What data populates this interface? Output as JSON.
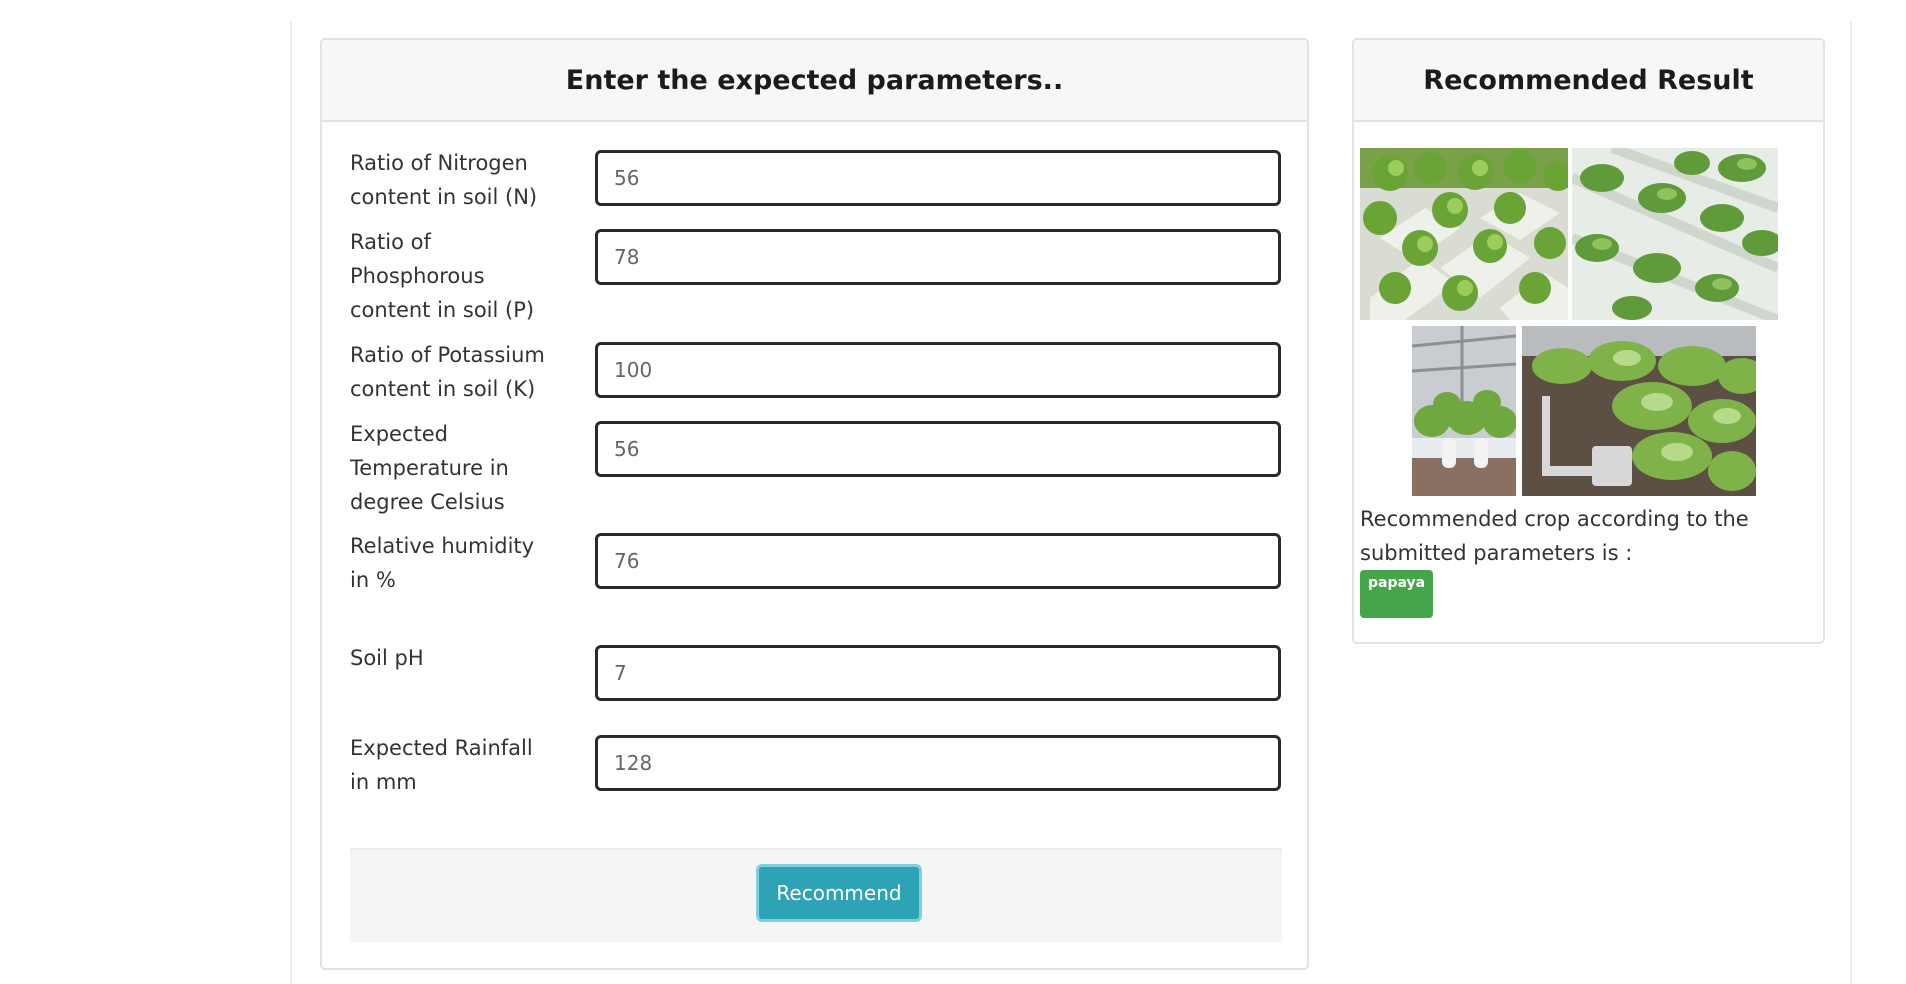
{
  "form": {
    "title": "Enter the expected parameters..",
    "fields": [
      {
        "label": "Ratio of Nitrogen content in soil (N)",
        "value": "56"
      },
      {
        "label": "Ratio of Phosphorous content in soil (P)",
        "value": "78"
      },
      {
        "label": "Ratio of Potassium content in soil (K)",
        "value": "100"
      },
      {
        "label": "Expected Temperature in degree Celsius",
        "value": "56"
      },
      {
        "label": "Relative humidity in %",
        "value": "76"
      },
      {
        "label": "Soil pH",
        "value": "7"
      },
      {
        "label": "Expected Rainfall in mm",
        "value": "128"
      }
    ],
    "submit_label": "Recommend"
  },
  "result": {
    "title": "Recommended Result",
    "text": "Recommended crop according to the submitted parameters is :",
    "crop": "papaya"
  },
  "colors": {
    "button_bg": "#2ea3b5",
    "badge_bg": "#44a648",
    "header_bg": "#f7f7f7"
  }
}
